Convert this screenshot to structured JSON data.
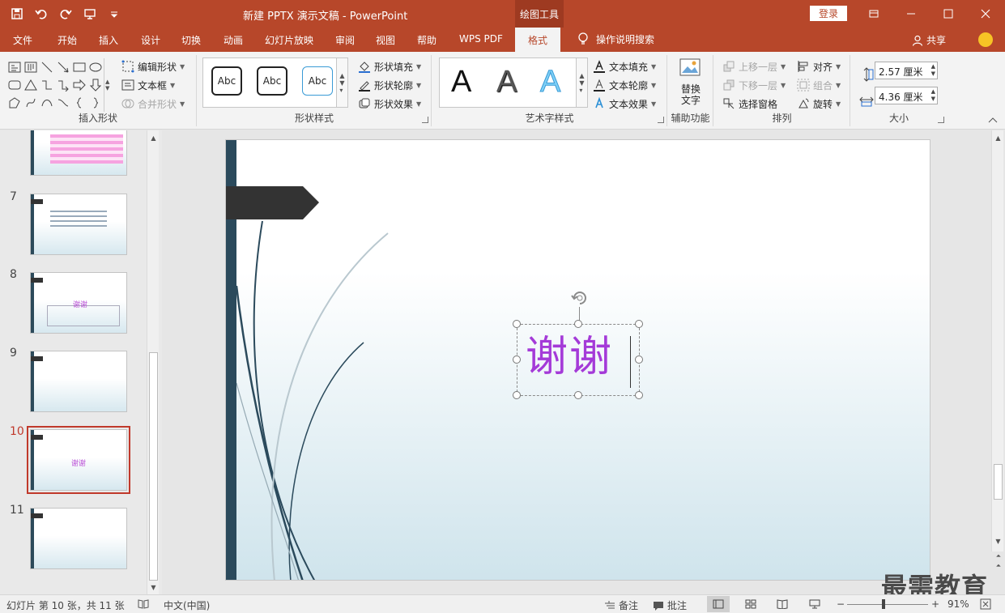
{
  "titlebar": {
    "doc_title": "新建 PPTX 演示文稿  -  PowerPoint",
    "contextual_tab": "绘图工具",
    "login": "登录"
  },
  "tabs": [
    "文件",
    "开始",
    "插入",
    "设计",
    "切换",
    "动画",
    "幻灯片放映",
    "审阅",
    "视图",
    "帮助",
    "WPS PDF",
    "格式"
  ],
  "tell_me": "操作说明搜索",
  "share": "共享",
  "ribbon": {
    "insert_shapes": {
      "label": "插入形状",
      "edit_shape": "编辑形状",
      "text_box": "文本框",
      "merge_shapes": "合并形状"
    },
    "shape_styles": {
      "label": "形状样式",
      "samples": [
        "Abc",
        "Abc",
        "Abc"
      ],
      "fill": "形状填充",
      "outline": "形状轮廓",
      "effects": "形状效果"
    },
    "wordart_styles": {
      "label": "艺术字样式",
      "samples": [
        "A",
        "A",
        "A"
      ],
      "text_fill": "文本填充",
      "text_outline": "文本轮廓",
      "text_effects": "文本效果"
    },
    "accessibility": {
      "label": "辅助功能",
      "alt_text_1": "替换",
      "alt_text_2": "文字"
    },
    "arrange": {
      "label": "排列",
      "bring_forward": "上移一层",
      "send_backward": "下移一层",
      "selection_pane": "选择窗格",
      "align": "对齐",
      "group": "组合",
      "rotate": "旋转"
    },
    "size": {
      "label": "大小",
      "height": "2.57 厘米",
      "width": "4.36 厘米"
    }
  },
  "thumbnails": [
    {
      "num": "7",
      "text": ""
    },
    {
      "num": "8",
      "text": "谢谢"
    },
    {
      "num": "9",
      "text": ""
    },
    {
      "num": "10",
      "text": "谢谢"
    },
    {
      "num": "11",
      "text": ""
    }
  ],
  "slide": {
    "text": "谢谢"
  },
  "watermark": "最需教育",
  "status": {
    "slide_count": "幻灯片 第 10 张，共 11 张",
    "language": "中文(中国)",
    "notes": "备注",
    "comments": "批注",
    "zoom": "91%"
  },
  "colors": {
    "brand": "#b7472a",
    "text_accent": "#a43ad8",
    "slide_bar": "#2b4a5c"
  }
}
